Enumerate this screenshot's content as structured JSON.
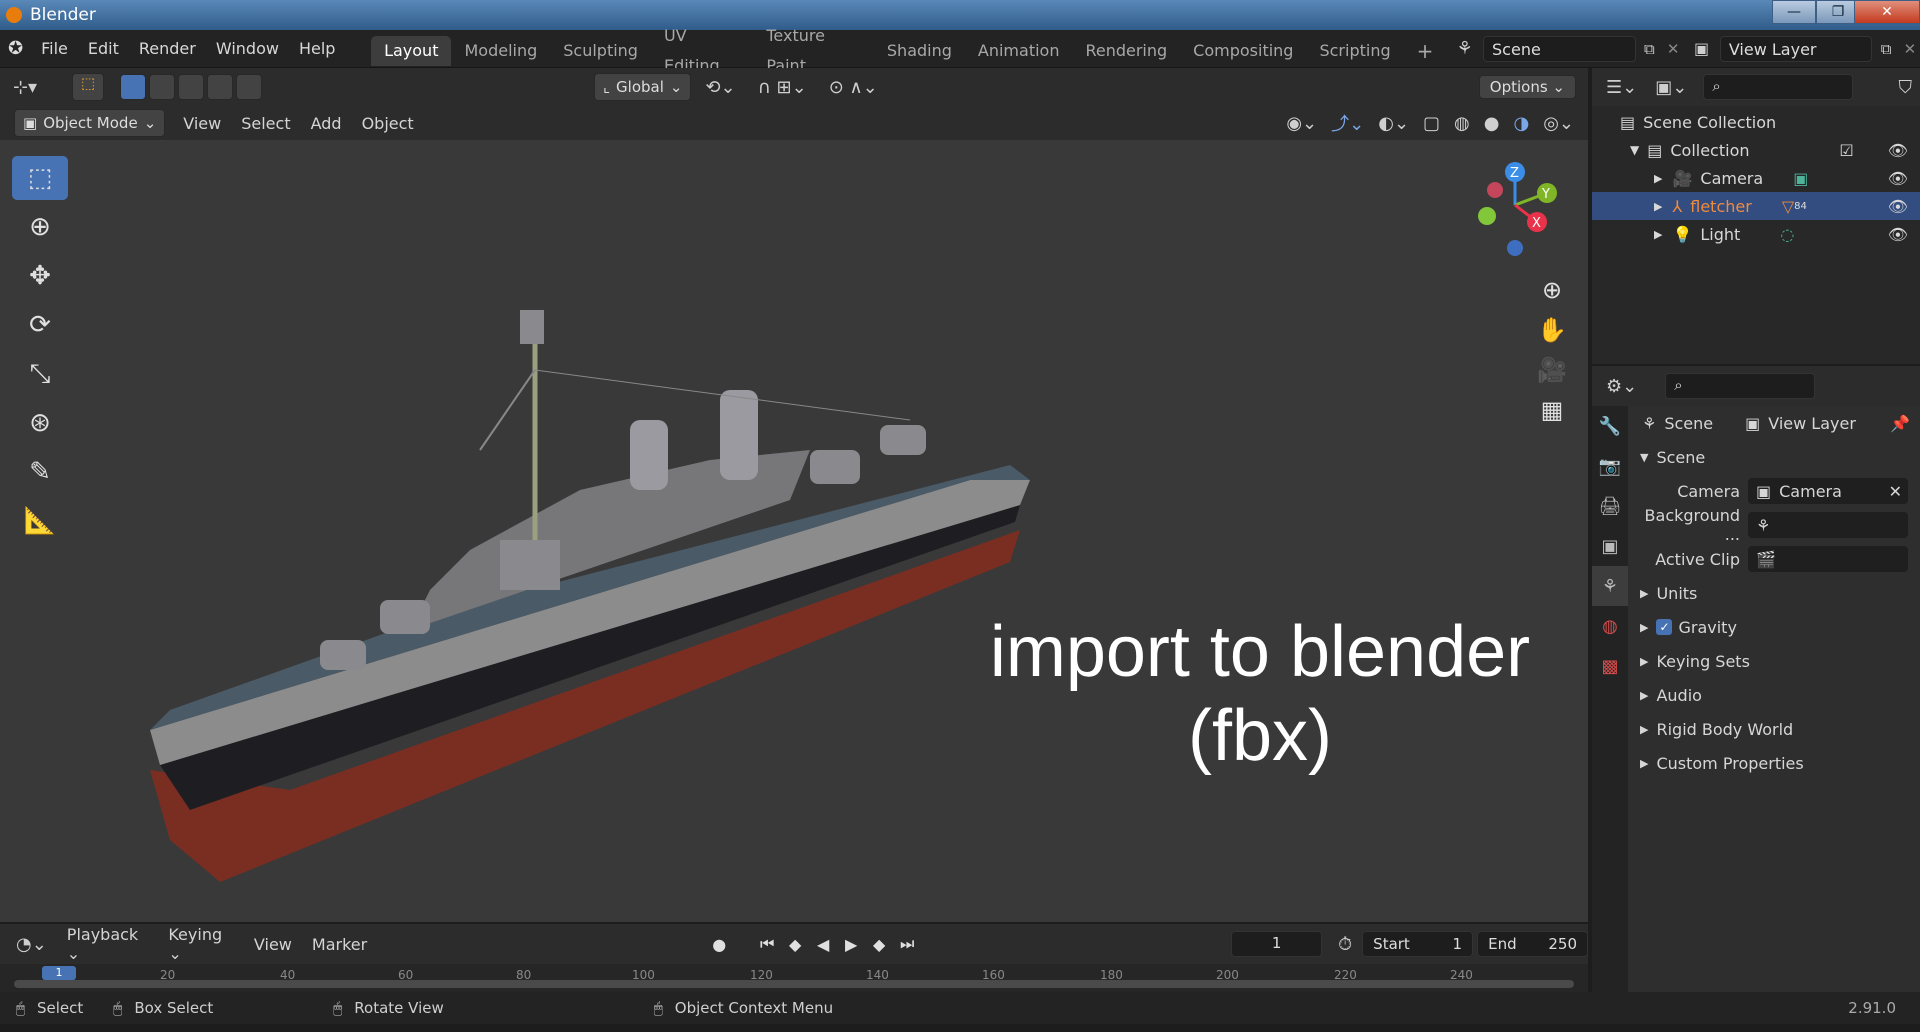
{
  "window": {
    "title": "Blender",
    "buttons": [
      "—",
      "❐",
      "✕"
    ]
  },
  "menu": [
    "File",
    "Edit",
    "Render",
    "Window",
    "Help"
  ],
  "workspaces": [
    "Layout",
    "Modeling",
    "Sculpting",
    "UV Editing",
    "Texture Paint",
    "Shading",
    "Animation",
    "Rendering",
    "Compositing",
    "Scripting"
  ],
  "active_workspace": "Layout",
  "add_tab": "+",
  "scene_field": "Scene",
  "view_layer_field": "View Layer",
  "tools_header": {
    "orientation": "Global",
    "options": "Options"
  },
  "viewport_header": {
    "mode": "Object Mode",
    "items": [
      "View",
      "Select",
      "Add",
      "Object"
    ]
  },
  "gizmo": {
    "z": "Z",
    "y": "Y",
    "x": "X"
  },
  "overlay_text": {
    "line1": "import to blender",
    "line2": "(fbx)"
  },
  "outliner": {
    "root": "Scene Collection",
    "collection": "Collection",
    "items": [
      {
        "name": "Camera",
        "color": "#d8d8d8"
      },
      {
        "name": "fletcher",
        "color": "#f08a3c"
      },
      {
        "name": "Light",
        "color": "#d8d8d8"
      }
    ],
    "badge": "84"
  },
  "properties": {
    "breadcrumb": [
      "Scene",
      "View Layer"
    ],
    "section": "Scene",
    "fields": [
      {
        "label": "Camera",
        "value": "Camera"
      },
      {
        "label": "Background ...",
        "value": ""
      },
      {
        "label": "Active Clip",
        "value": ""
      }
    ],
    "panels": [
      "Units",
      "Gravity",
      "Keying Sets",
      "Audio",
      "Rigid Body World",
      "Custom Properties"
    ],
    "gravity_checked": true
  },
  "timeline": {
    "menus": [
      "Playback",
      "Keying",
      "View",
      "Marker"
    ],
    "current_frame": "1",
    "start_label": "Start",
    "start": "1",
    "end_label": "End",
    "end": "250",
    "ticks": [
      "1",
      "20",
      "40",
      "60",
      "80",
      "100",
      "120",
      "140",
      "160",
      "180",
      "200",
      "220",
      "240"
    ]
  },
  "status": {
    "select": "Select",
    "box_select": "Box Select",
    "rotate": "Rotate View",
    "context": "Object Context Menu",
    "version": "2.91.0"
  }
}
